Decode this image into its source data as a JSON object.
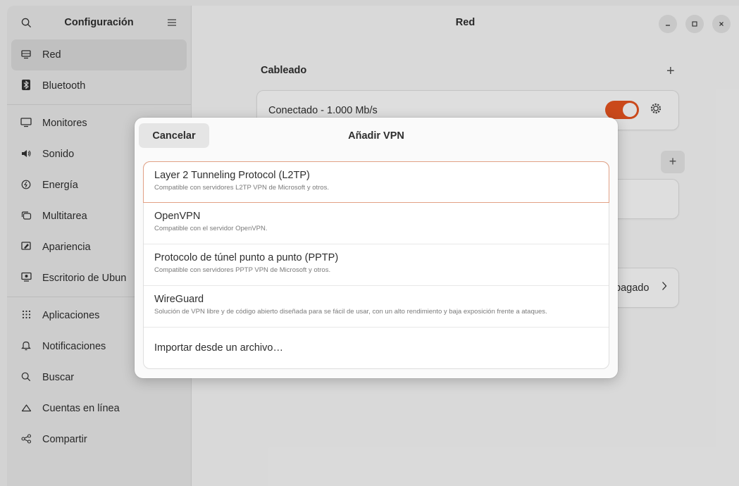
{
  "sidebar": {
    "title": "Configuración",
    "search_icon": "search-icon",
    "menu_icon": "hamburger-menu-icon",
    "groups": [
      [
        {
          "icon": "network-icon",
          "label": "Red",
          "active": true
        },
        {
          "icon": "bluetooth-icon",
          "label": "Bluetooth"
        }
      ],
      [
        {
          "icon": "monitor-icon",
          "label": "Monitores"
        },
        {
          "icon": "speaker-icon",
          "label": "Sonido"
        },
        {
          "icon": "power-icon",
          "label": "Energía"
        },
        {
          "icon": "multitask-icon",
          "label": "Multitarea"
        },
        {
          "icon": "appearance-icon",
          "label": "Apariencia"
        },
        {
          "icon": "desktop-icon",
          "label": "Escritorio de Ubun"
        }
      ],
      [
        {
          "icon": "apps-grid-icon",
          "label": "Aplicaciones"
        },
        {
          "icon": "bell-icon",
          "label": "Notificaciones"
        },
        {
          "icon": "search-icon",
          "label": "Buscar"
        },
        {
          "icon": "cloud-icon",
          "label": "Cuentas en línea"
        },
        {
          "icon": "share-icon",
          "label": "Compartir"
        }
      ]
    ]
  },
  "main": {
    "title": "Red",
    "wired_section_label": "Cableado",
    "wired_status": "Conectado - 1.000 Mb/s",
    "vpn_status_partial": "pagado",
    "toggle_on": true,
    "accent_color": "#e95420"
  },
  "dialog": {
    "title": "Añadir VPN",
    "cancel_label": "Cancelar",
    "options": [
      {
        "name": "Layer 2 Tunneling Protocol (L2TP)",
        "description": "Compatible con servidores L2TP VPN de Microsoft y otros."
      },
      {
        "name": "OpenVPN",
        "description": "Compatible con el servidor OpenVPN."
      },
      {
        "name": "Protocolo de túnel punto a punto (PPTP)",
        "description": "Compatible con servidores PPTP VPN de Microsoft y otros."
      },
      {
        "name": "WireGuard",
        "description": "Solución de VPN libre y de código abierto diseñada para se fácil de usar, con un alto rendimiento y baja exposición frente a ataques."
      }
    ],
    "import_label": "Importar desde un archivo…"
  }
}
